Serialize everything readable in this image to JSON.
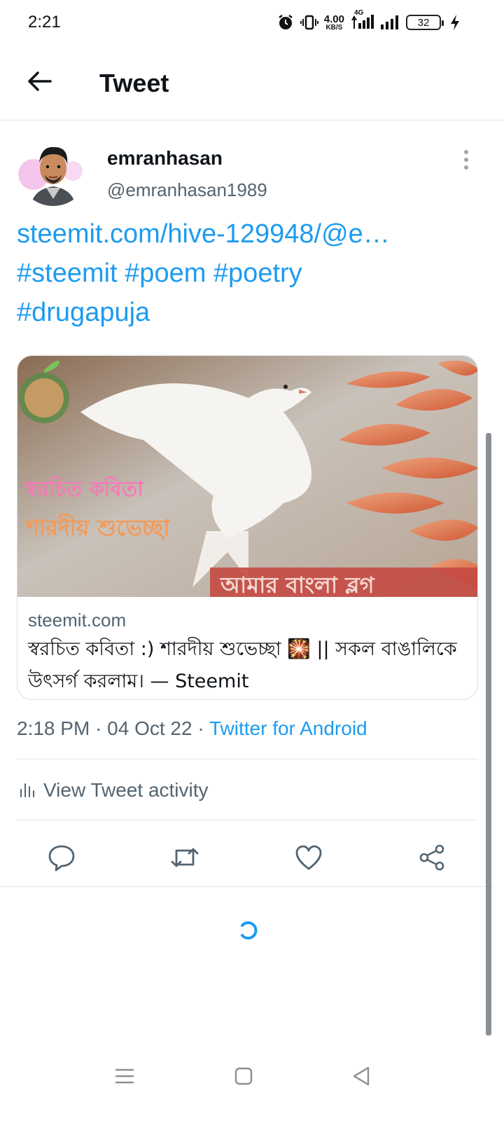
{
  "status_bar": {
    "time": "2:21",
    "net_speed_value": "4.00",
    "net_speed_unit": "KB/S",
    "network_type": "4G",
    "battery_level": "32"
  },
  "header": {
    "title": "Tweet"
  },
  "tweet": {
    "author_name": "emranhasan",
    "author_handle": "@emranhasan1989",
    "link_text": "steemit.com/hive-129948/@e…",
    "hashtags_line1": "#steemit #poem #poetry",
    "hashtags_line2": "#drugapuja",
    "card": {
      "image_text_1": "স্বরচিত কবিতা",
      "image_text_2": "শারদীয় শুভেচ্ছা",
      "image_banner": "আমার বাংলা ব্লগ",
      "domain": "steemit.com",
      "title": "স্বরচিত কবিতা :) শারদীয় শুভেচ্ছা 🎇 || সকল বাঙালিকে উৎসর্গ করলাম। — Steemit"
    },
    "time": "2:18 PM",
    "date": "04 Oct 22",
    "separator": "·",
    "source": "Twitter for Android",
    "activity_label": "View Tweet activity"
  },
  "colors": {
    "link": "#1d9bf0",
    "secondary_text": "#536471",
    "divider": "#e1e5e8"
  },
  "icons": {
    "back": "arrow-left-icon",
    "more": "more-vertical-icon",
    "reply": "reply-icon",
    "retweet": "retweet-icon",
    "like": "heart-icon",
    "share": "share-icon",
    "activity": "bar-chart-icon"
  }
}
